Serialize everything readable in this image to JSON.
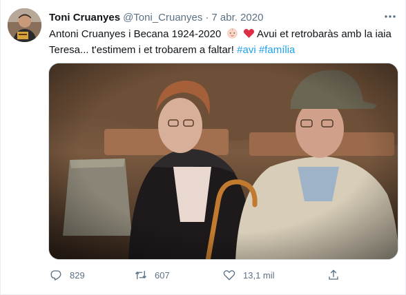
{
  "author": {
    "name": "Toni Cruanyes",
    "handle": "@Toni_Cruanyes",
    "separator": "·",
    "date": "7 abr. 2020"
  },
  "tweet": {
    "line1_text": "Antoni Cruanyes i Becana 1924-2020",
    "line1_emojis": [
      "baby-face-emoji",
      "red-heart-emoji"
    ],
    "line1_after": "Avui et retrobaràs amb la iaia",
    "line2_text": "Teresa... t'estimem i et trobarem a faltar!",
    "hashtags": [
      "#avi",
      "#família"
    ]
  },
  "photo": {
    "alt": "photo-elderly-couple-sitting-on-bench"
  },
  "actions": {
    "replies": "829",
    "retweets": "607",
    "likes": "13,1 mil"
  },
  "icons": {
    "more": "more-dots-icon",
    "reply": "reply-bubble-icon",
    "retweet": "retweet-icon",
    "like": "heart-icon",
    "share": "share-icon"
  },
  "colors": {
    "link": "#1da1f2",
    "secondary": "#5b7083",
    "heart": "#e0245e"
  }
}
